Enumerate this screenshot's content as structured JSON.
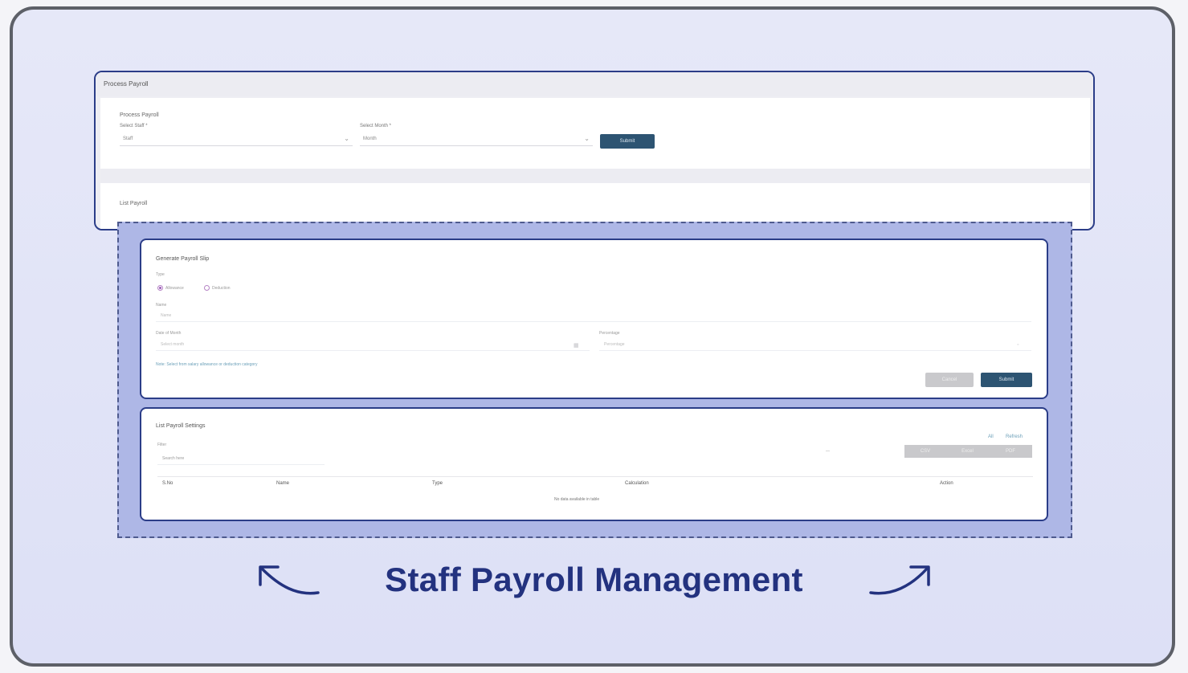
{
  "caption": "Staff Payroll Management",
  "top_panel": {
    "title": "Process Payroll",
    "form_title": "Process Payroll",
    "select_staff_label": "Select Staff *",
    "select_staff_value": "Staff",
    "select_month_label": "Select Month *",
    "select_month_value": "Month",
    "submit_label": "Submit",
    "list_title": "List Payroll"
  },
  "form_card": {
    "title": "Generate Payroll Slip",
    "type_label": "Type",
    "radio_options": [
      "Allowance",
      "Deduction"
    ],
    "name_label": "Name",
    "name_placeholder": "Name",
    "date_label": "Date of Month",
    "date_placeholder": "Select month",
    "amount_label": "Percentage",
    "amount_placeholder": "Percentage",
    "help_link": "Note: Select from salary allowance or deduction category",
    "cancel_label": "Cancel",
    "save_label": "Submit"
  },
  "list_card": {
    "title": "List Payroll Settings",
    "search_label": "Filter",
    "search_placeholder": "Search here",
    "top_links": [
      "All",
      "Refresh"
    ],
    "page_info": "—",
    "export_buttons": [
      "CSV",
      "Excel",
      "PDF"
    ],
    "columns": [
      "S.No",
      "Name",
      "Type",
      "Calculation",
      "Action"
    ],
    "empty_text": "No data available in table"
  },
  "colors": {
    "accent": "#2d5472",
    "frame_border": "#5d6068",
    "panel_border": "#2b3d88",
    "dashed_fill": "#aeb7e6",
    "caption": "#23327f"
  }
}
